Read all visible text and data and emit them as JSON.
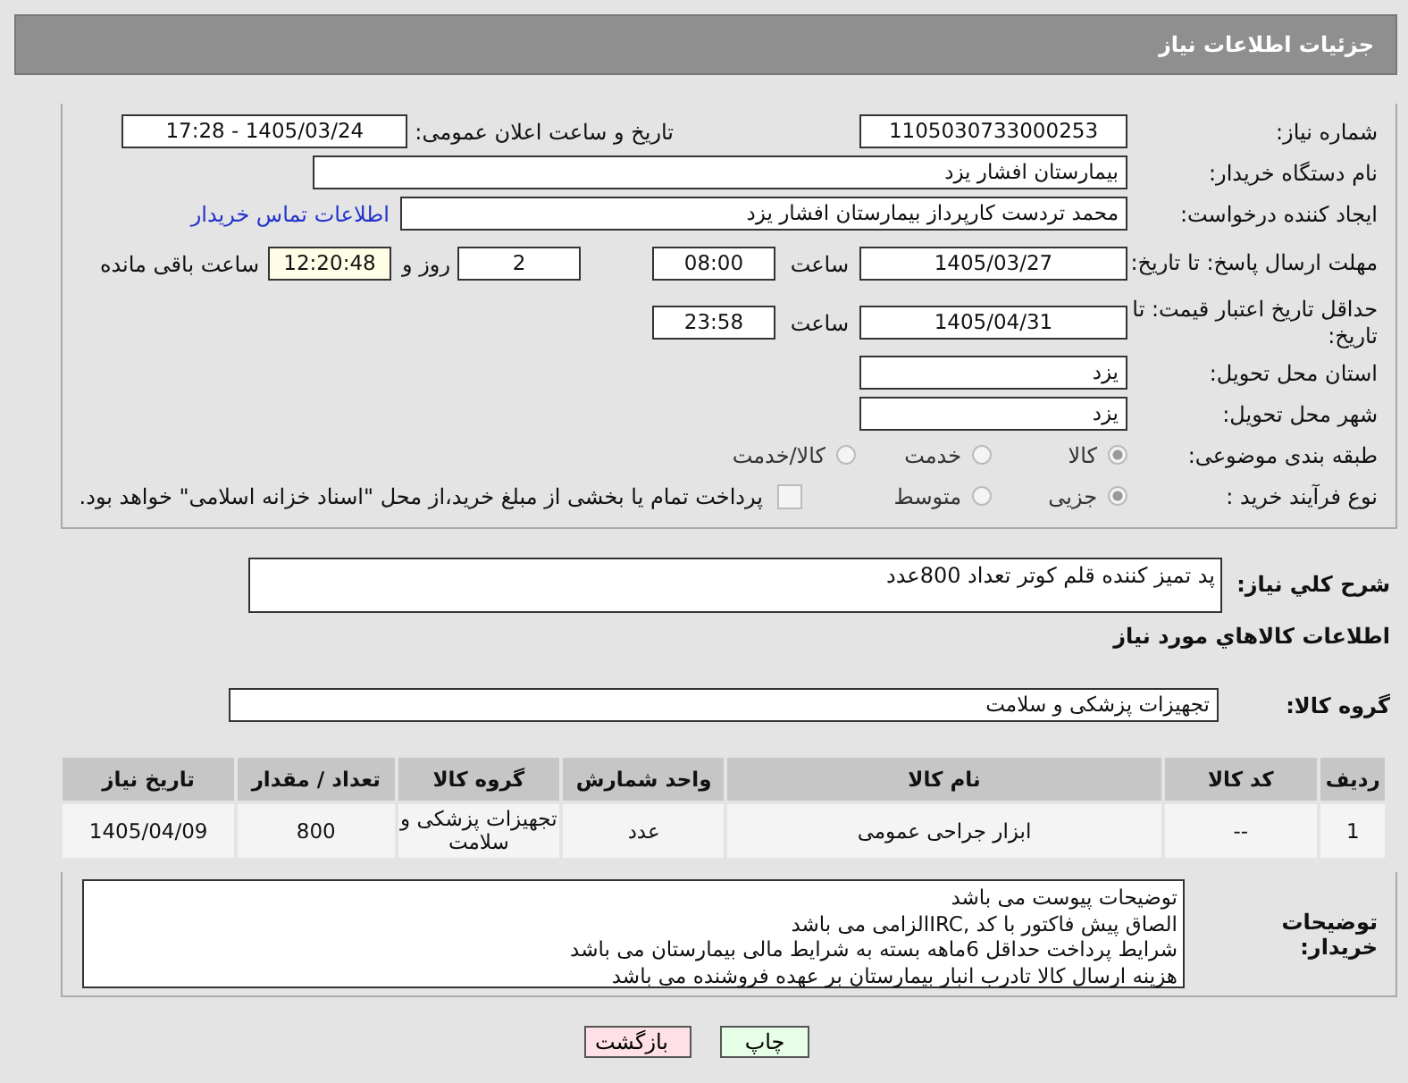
{
  "header": {
    "title": "جزئیات اطلاعات نیاز"
  },
  "need_number": {
    "label": "شماره نیاز:",
    "value": "1105030733000253"
  },
  "announce": {
    "label": "تاریخ و ساعت اعلان عمومی:",
    "value": "1405/03/24 - 17:28"
  },
  "buyer_org": {
    "label": "نام دستگاه خریدار:",
    "value": "بیمارستان افشار یزد"
  },
  "creator": {
    "label": "ایجاد کننده درخواست:",
    "value": "محمد تردست کارپرداز بیمارستان افشار یزد",
    "link": "اطلاعات تماس خریدار"
  },
  "deadline": {
    "label": "مهلت ارسال پاسخ: تا تاریخ:",
    "date": "1405/03/27",
    "time_label": "ساعت",
    "time": "08:00",
    "days": "2",
    "days_label": "روز و",
    "remaining": "12:20:48",
    "remaining_label": "ساعت باقی مانده"
  },
  "validity": {
    "label": "حداقل تاریخ اعتبار قیمت: تا تاریخ:",
    "date": "1405/04/31",
    "time_label": "ساعت",
    "time": "23:58"
  },
  "province": {
    "label": "استان محل تحویل:",
    "value": "یزد"
  },
  "city": {
    "label": "شهر محل تحویل:",
    "value": "یزد"
  },
  "classification": {
    "label": "طبقه بندی موضوعی:",
    "options": [
      {
        "label": "کالا",
        "selected": true
      },
      {
        "label": "خدمت",
        "selected": false
      },
      {
        "label": "کالا/خدمت",
        "selected": false
      }
    ]
  },
  "purchase_type": {
    "label": "نوع فرآیند خرید :",
    "options": [
      {
        "label": "جزیی",
        "selected": true
      },
      {
        "label": "متوسط",
        "selected": false
      }
    ],
    "treasury": {
      "checked": false,
      "text": "پرداخت تمام یا بخشی از مبلغ خرید،از محل \"اسناد خزانه اسلامی\" خواهد بود."
    }
  },
  "description": {
    "label": "شرح کلي نياز:",
    "value": "پد تمیز کننده قلم کوتر تعداد 800عدد"
  },
  "goods_heading": "اطلاعات کالاهاي مورد نياز",
  "goods_group": {
    "label": "گروه کالا:",
    "value": "تجهیزات پزشکی و سلامت"
  },
  "table": {
    "columns": [
      "ردیف",
      "کد کالا",
      "نام کالا",
      "واحد شمارش",
      "گروه کالا",
      "تعداد / مقدار",
      "تاریخ نیاز"
    ],
    "rows": [
      [
        "1",
        "--",
        "ابزار جراحی عمومی",
        "عدد",
        "تجهیزات پزشکی و سلامت",
        "800",
        "1405/04/09"
      ]
    ]
  },
  "buyer_notes": {
    "label": "توضیحات خریدار:",
    "lines": [
      "توضیحات پیوست می باشد",
      "الصاق پیش فاکتور با کد  ,IRCالزامی می باشد",
      "شرایط پرداخت حداقل 6ماهه بسته به شرایط مالی بیمارستان می باشد",
      "هزینه ارسال کالا تادرب انبار بیمارستان بر عهده فروشنده می باشد"
    ]
  },
  "buttons": [
    {
      "label": "چاپ",
      "kind": "print"
    },
    {
      "label": "بازگشت",
      "kind": "back"
    }
  ]
}
